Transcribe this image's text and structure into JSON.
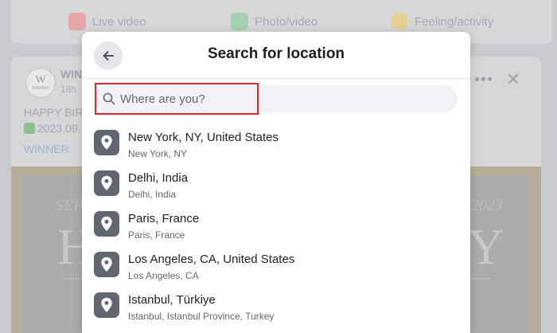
{
  "background": {
    "composer": {
      "live_label": "Live video",
      "photo_label": "Photo/video",
      "feeling_label": "Feeling/activity"
    },
    "post": {
      "logo_letter": "W",
      "logo_text": "WINNER",
      "author": "WIN",
      "time": "18h",
      "text_line1": "HAPPY BIRT",
      "text_line2": "2023.09.",
      "tag": "WINNER",
      "image_left_small": "SEP",
      "image_right_small": "2023",
      "image_left_big": "H",
      "image_right_big": "Y"
    }
  },
  "modal": {
    "title": "Search for location",
    "search": {
      "placeholder": "Where are you?",
      "value": ""
    },
    "locations": [
      {
        "name": "New York, NY, United States",
        "sub": "New York, NY"
      },
      {
        "name": "Delhi, India",
        "sub": "Delhi, India"
      },
      {
        "name": "Paris, France",
        "sub": "Paris, France"
      },
      {
        "name": "Los Angeles, CA, United States",
        "sub": "Los Angeles, CA"
      },
      {
        "name": "Istanbul, Türkiye",
        "sub": "Istanbul, Istanbul Province, Turkey"
      }
    ]
  },
  "colors": {
    "highlight": "#e4232b",
    "pin_bg": "#606770",
    "search_bg": "#f0f2f5"
  },
  "icons": {
    "back": "arrow-left-icon",
    "search": "magnifier-icon",
    "location": "map-pin-icon",
    "more": "more-dots-icon",
    "close": "close-icon"
  }
}
